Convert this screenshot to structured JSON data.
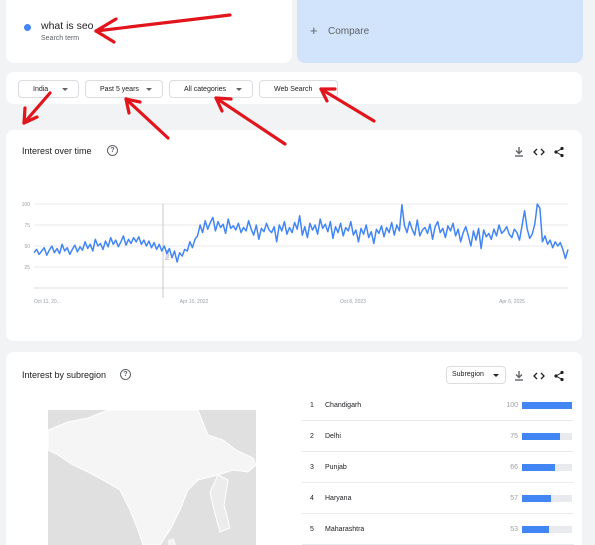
{
  "search": {
    "term": "what is seo",
    "term_type": "Search term",
    "term_color": "#4285f4",
    "compare_label": "Compare"
  },
  "filters": {
    "location": "India",
    "time_range": "Past 5 years",
    "category": "All categories",
    "search_type": "Web Search"
  },
  "interest_over_time": {
    "title": "Interest over time",
    "icons": [
      "help-icon",
      "download-icon",
      "embed-icon",
      "share-icon"
    ],
    "note_label": "Note",
    "chart_data": {
      "type": "line",
      "ylim": [
        0,
        100
      ],
      "y_ticks": [
        "100",
        "75",
        "50",
        "25"
      ],
      "x_tick_labels": [
        "Oct 11, 20...",
        "Apr 10, 2022",
        "Oct 8, 2023",
        "Apr 6, 2025"
      ],
      "series": [
        {
          "color": "#4285f4",
          "values": [
            42,
            46,
            40,
            44,
            48,
            39,
            45,
            50,
            42,
            47,
            41,
            52,
            44,
            48,
            40,
            46,
            51,
            43,
            49,
            45,
            55,
            47,
            52,
            44,
            58,
            50,
            53,
            46,
            56,
            49,
            60,
            52,
            57,
            49,
            55,
            62,
            51,
            58,
            53,
            60,
            55,
            61,
            52,
            57,
            50,
            56,
            48,
            54,
            46,
            52,
            44,
            50,
            41,
            47,
            36,
            44,
            31,
            42,
            38,
            46,
            44,
            55,
            48,
            58,
            62,
            75,
            66,
            80,
            70,
            78,
            84,
            68,
            79,
            72,
            76,
            65,
            82,
            71,
            74,
            69,
            77,
            66,
            72,
            68,
            80,
            70,
            63,
            75,
            58,
            71,
            67,
            77,
            69,
            66,
            73,
            55,
            75,
            68,
            79,
            64,
            72,
            66,
            78,
            70,
            86,
            63,
            73,
            60,
            77,
            69,
            75,
            64,
            82,
            71,
            76,
            67,
            79,
            59,
            73,
            66,
            77,
            62,
            72,
            68,
            79,
            63,
            69,
            55,
            71,
            64,
            75,
            60,
            67,
            53,
            70,
            65,
            74,
            61,
            72,
            66,
            78,
            63,
            75,
            68,
            99,
            74,
            66,
            79,
            70,
            63,
            81,
            62,
            69,
            72,
            65,
            76,
            58,
            73,
            79,
            66,
            71,
            60,
            74,
            68,
            77,
            62,
            70,
            55,
            66,
            73,
            62,
            50,
            68,
            57,
            71,
            47,
            69,
            61,
            65,
            58,
            70,
            62,
            75,
            65,
            68,
            73,
            64,
            60,
            70,
            66,
            57,
            74,
            92,
            71,
            59,
            64,
            76,
            100,
            95,
            55,
            62,
            52,
            57,
            48,
            55,
            50,
            54,
            46,
            35,
            46
          ]
        }
      ]
    }
  },
  "interest_by_subregion": {
    "title": "Interest by subregion",
    "selector": "Subregion",
    "icons": [
      "help-icon",
      "download-icon",
      "embed-icon",
      "share-icon"
    ],
    "rows": [
      {
        "rank": "1",
        "name": "Chandigarh",
        "score": "100",
        "value": 100
      },
      {
        "rank": "2",
        "name": "Delhi",
        "score": "75",
        "value": 75
      },
      {
        "rank": "3",
        "name": "Punjab",
        "score": "66",
        "value": 66
      },
      {
        "rank": "4",
        "name": "Haryana",
        "score": "57",
        "value": 57
      },
      {
        "rank": "5",
        "name": "Maharashtra",
        "score": "53",
        "value": 53
      }
    ]
  }
}
